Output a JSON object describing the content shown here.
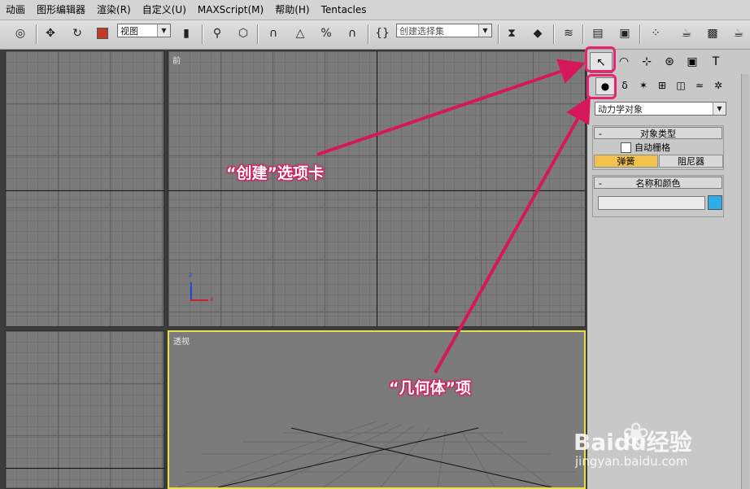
{
  "menu": [
    "动画",
    "图形编辑器",
    "渲染(R)",
    "自定义(U)",
    "MAXScript(M)",
    "帮助(H)",
    "Tentacles"
  ],
  "toolbar": {
    "view_dropdown": "视图",
    "selection_set_placeholder": "创建选择集"
  },
  "viewports": {
    "front_label": "前",
    "perspective_label": "透视",
    "axis_z": "z",
    "axis_x": "x"
  },
  "command_panel": {
    "category_dropdown": "动力学对象",
    "object_type": {
      "title": "对象类型",
      "collapse": "-",
      "autogrid_label": "自动栅格",
      "buttons": [
        "弹簧",
        "阻尼器"
      ]
    },
    "name_color": {
      "title": "名称和颜色",
      "collapse": "-",
      "name_value": "",
      "color": "#2eaee8"
    }
  },
  "annotations": {
    "create_tab": "“创建”选项卡",
    "geometry_item": "“几何体”项"
  },
  "watermark": {
    "brand": "Baidu经验",
    "url": "jingyan.baidu.com"
  },
  "colors": {
    "annotation": "#d6185a",
    "highlight_box": "#e8246e",
    "active_viewport_border": "#e8e24a",
    "active_button": "#f2c14e"
  }
}
